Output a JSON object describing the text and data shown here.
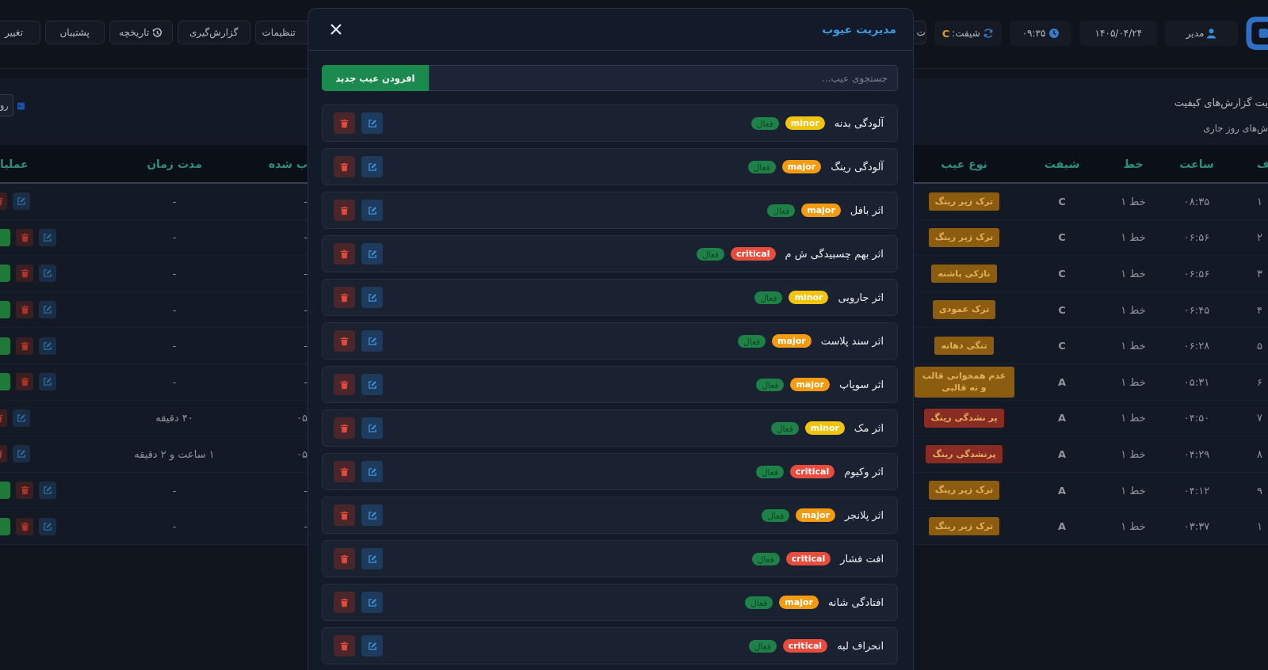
{
  "top_bar": {
    "buttons": [
      {
        "label": "ت",
        "kind": "text"
      },
      {
        "label": "تنظیمات",
        "kind": "text"
      },
      {
        "label": "گزارش‌گیری",
        "kind": "text"
      },
      {
        "label": "تاریخچه",
        "kind": "history"
      },
      {
        "label": "پشتیبان",
        "kind": "text"
      },
      {
        "label": "تغییر",
        "kind": "text"
      }
    ],
    "shift": {
      "label": "شیفت:",
      "value": "C"
    },
    "time": "۰۹:۳۵",
    "date": "۱۴۰۵/۰۴/۲۴",
    "user": "مدیر"
  },
  "report_card": {
    "title": "یت گزارش‌های کیفیت",
    "subtitle": "ش‌های روز جاری",
    "button": "رو"
  },
  "table": {
    "columns": {
      "column_1": "ف",
      "time": "ساعت",
      "line": "خط",
      "shift": "شیفت",
      "defect": "نوع عیب",
      "column_6": "ب شده",
      "duration": "مدت زمان",
      "actions": "عملیا"
    },
    "rows": [
      {
        "column_1": "۱",
        "time": "۰۸:۳۵",
        "line": "خط ۱",
        "shift": "C",
        "defect": {
          "label": "ترک زیر رینگ",
          "color": "#8c5c10"
        },
        "column_6": "-",
        "duration": "-",
        "confirm": false
      },
      {
        "column_1": "۲",
        "time": "۰۶:۵۶",
        "line": "خط ۱",
        "shift": "C",
        "defect": {
          "label": "ترک زیر رینگ",
          "color": "#8c5c10"
        },
        "column_6": "-",
        "duration": "-",
        "confirm": true
      },
      {
        "column_1": "۳",
        "time": "۰۶:۵۶",
        "line": "خط ۱",
        "shift": "C",
        "defect": {
          "label": "نازکی پاشنه",
          "color": "#8c5c10"
        },
        "column_6": "-",
        "duration": "-",
        "confirm": true
      },
      {
        "column_1": "۴",
        "time": "۰۶:۴۵",
        "line": "خط ۱",
        "shift": "C",
        "defect": {
          "label": "ترک عمودی",
          "color": "#8c5c10"
        },
        "column_6": "-",
        "duration": "-",
        "confirm": true
      },
      {
        "column_1": "۵",
        "time": "۰۶:۲۸",
        "line": "خط ۱",
        "shift": "C",
        "defect": {
          "label": "تنگی دهانه",
          "color": "#8c5c10"
        },
        "column_6": "-",
        "duration": "-",
        "confirm": true
      },
      {
        "column_1": "۶",
        "time": "۰۵:۳۱",
        "line": "خط ۱",
        "shift": "A",
        "defect": {
          "label": "عدم همخوانی قالب و ته قالبی",
          "color": "#8c5c10"
        },
        "column_6": "-",
        "duration": "-",
        "confirm": true
      },
      {
        "column_1": "۷",
        "time": "۰۴:۵۰",
        "line": "خط ۱",
        "shift": "A",
        "defect": {
          "label": "پر نشدگی رینگ",
          "color": "#8a2b24"
        },
        "column_6": "۰۵",
        "duration": "۴۰ دقیقه",
        "confirm": false
      },
      {
        "column_1": "۸",
        "time": "۰۴:۲۹",
        "line": "خط ۱",
        "shift": "A",
        "defect": {
          "label": "پرنشدگی رینگ",
          "color": "#8a2b24"
        },
        "column_6": "۰۵",
        "duration": "۱ ساعت و ۲ دقیقه",
        "confirm": false
      },
      {
        "column_1": "۹",
        "time": "۰۴:۱۲",
        "line": "خط ۱",
        "shift": "A",
        "defect": {
          "label": "ترک زیر رینگ",
          "color": "#8c5c10"
        },
        "column_6": "-",
        "duration": "-",
        "confirm": true
      },
      {
        "column_1": "۱",
        "time": "۰۳:۳۷",
        "line": "خط ۱",
        "shift": "A",
        "defect": {
          "label": "ترک زیر رینگ",
          "color": "#8c5c10"
        },
        "column_6": "-",
        "duration": "-",
        "confirm": true
      }
    ]
  },
  "modal": {
    "title": "مدیریت عیوب",
    "search": {
      "placeholder": "جستجوی عیب..."
    },
    "add_button": "افزودن عیب جدید",
    "defects": [
      {
        "name": "آلودگی بدنه",
        "severity": {
          "label": "minor",
          "color": "#f1c40f"
        },
        "status": "فعال"
      },
      {
        "name": "آلودگی رینگ",
        "severity": {
          "label": "major",
          "color": "#f39c12"
        },
        "status": "فعال"
      },
      {
        "name": "اثر بافل",
        "severity": {
          "label": "major",
          "color": "#f39c12"
        },
        "status": "فعال"
      },
      {
        "name": "اثر بهم چسبیدگی ش م",
        "severity": {
          "label": "critical",
          "color": "#e74c3c"
        },
        "status": "فعال"
      },
      {
        "name": "اثر جارویی",
        "severity": {
          "label": "minor",
          "color": "#f1c40f"
        },
        "status": "فعال"
      },
      {
        "name": "اثر سند پلاست",
        "severity": {
          "label": "major",
          "color": "#f39c12"
        },
        "status": "فعال"
      },
      {
        "name": "اثر سوپاپ",
        "severity": {
          "label": "major",
          "color": "#f39c12"
        },
        "status": "فعال"
      },
      {
        "name": "اثر مک",
        "severity": {
          "label": "minor",
          "color": "#f1c40f"
        },
        "status": "فعال"
      },
      {
        "name": "اثر وکیوم",
        "severity": {
          "label": "critical",
          "color": "#e74c3c"
        },
        "status": "فعال"
      },
      {
        "name": "اثر پلانجر",
        "severity": {
          "label": "major",
          "color": "#f39c12"
        },
        "status": "فعال"
      },
      {
        "name": "افت فشار",
        "severity": {
          "label": "critical",
          "color": "#e74c3c"
        },
        "status": "فعال"
      },
      {
        "name": "افتادگی شانه",
        "severity": {
          "label": "major",
          "color": "#f39c12"
        },
        "status": "فعال"
      },
      {
        "name": "انحراف لبه",
        "severity": {
          "label": "critical",
          "color": "#e74c3c"
        },
        "status": "فعال"
      }
    ]
  }
}
